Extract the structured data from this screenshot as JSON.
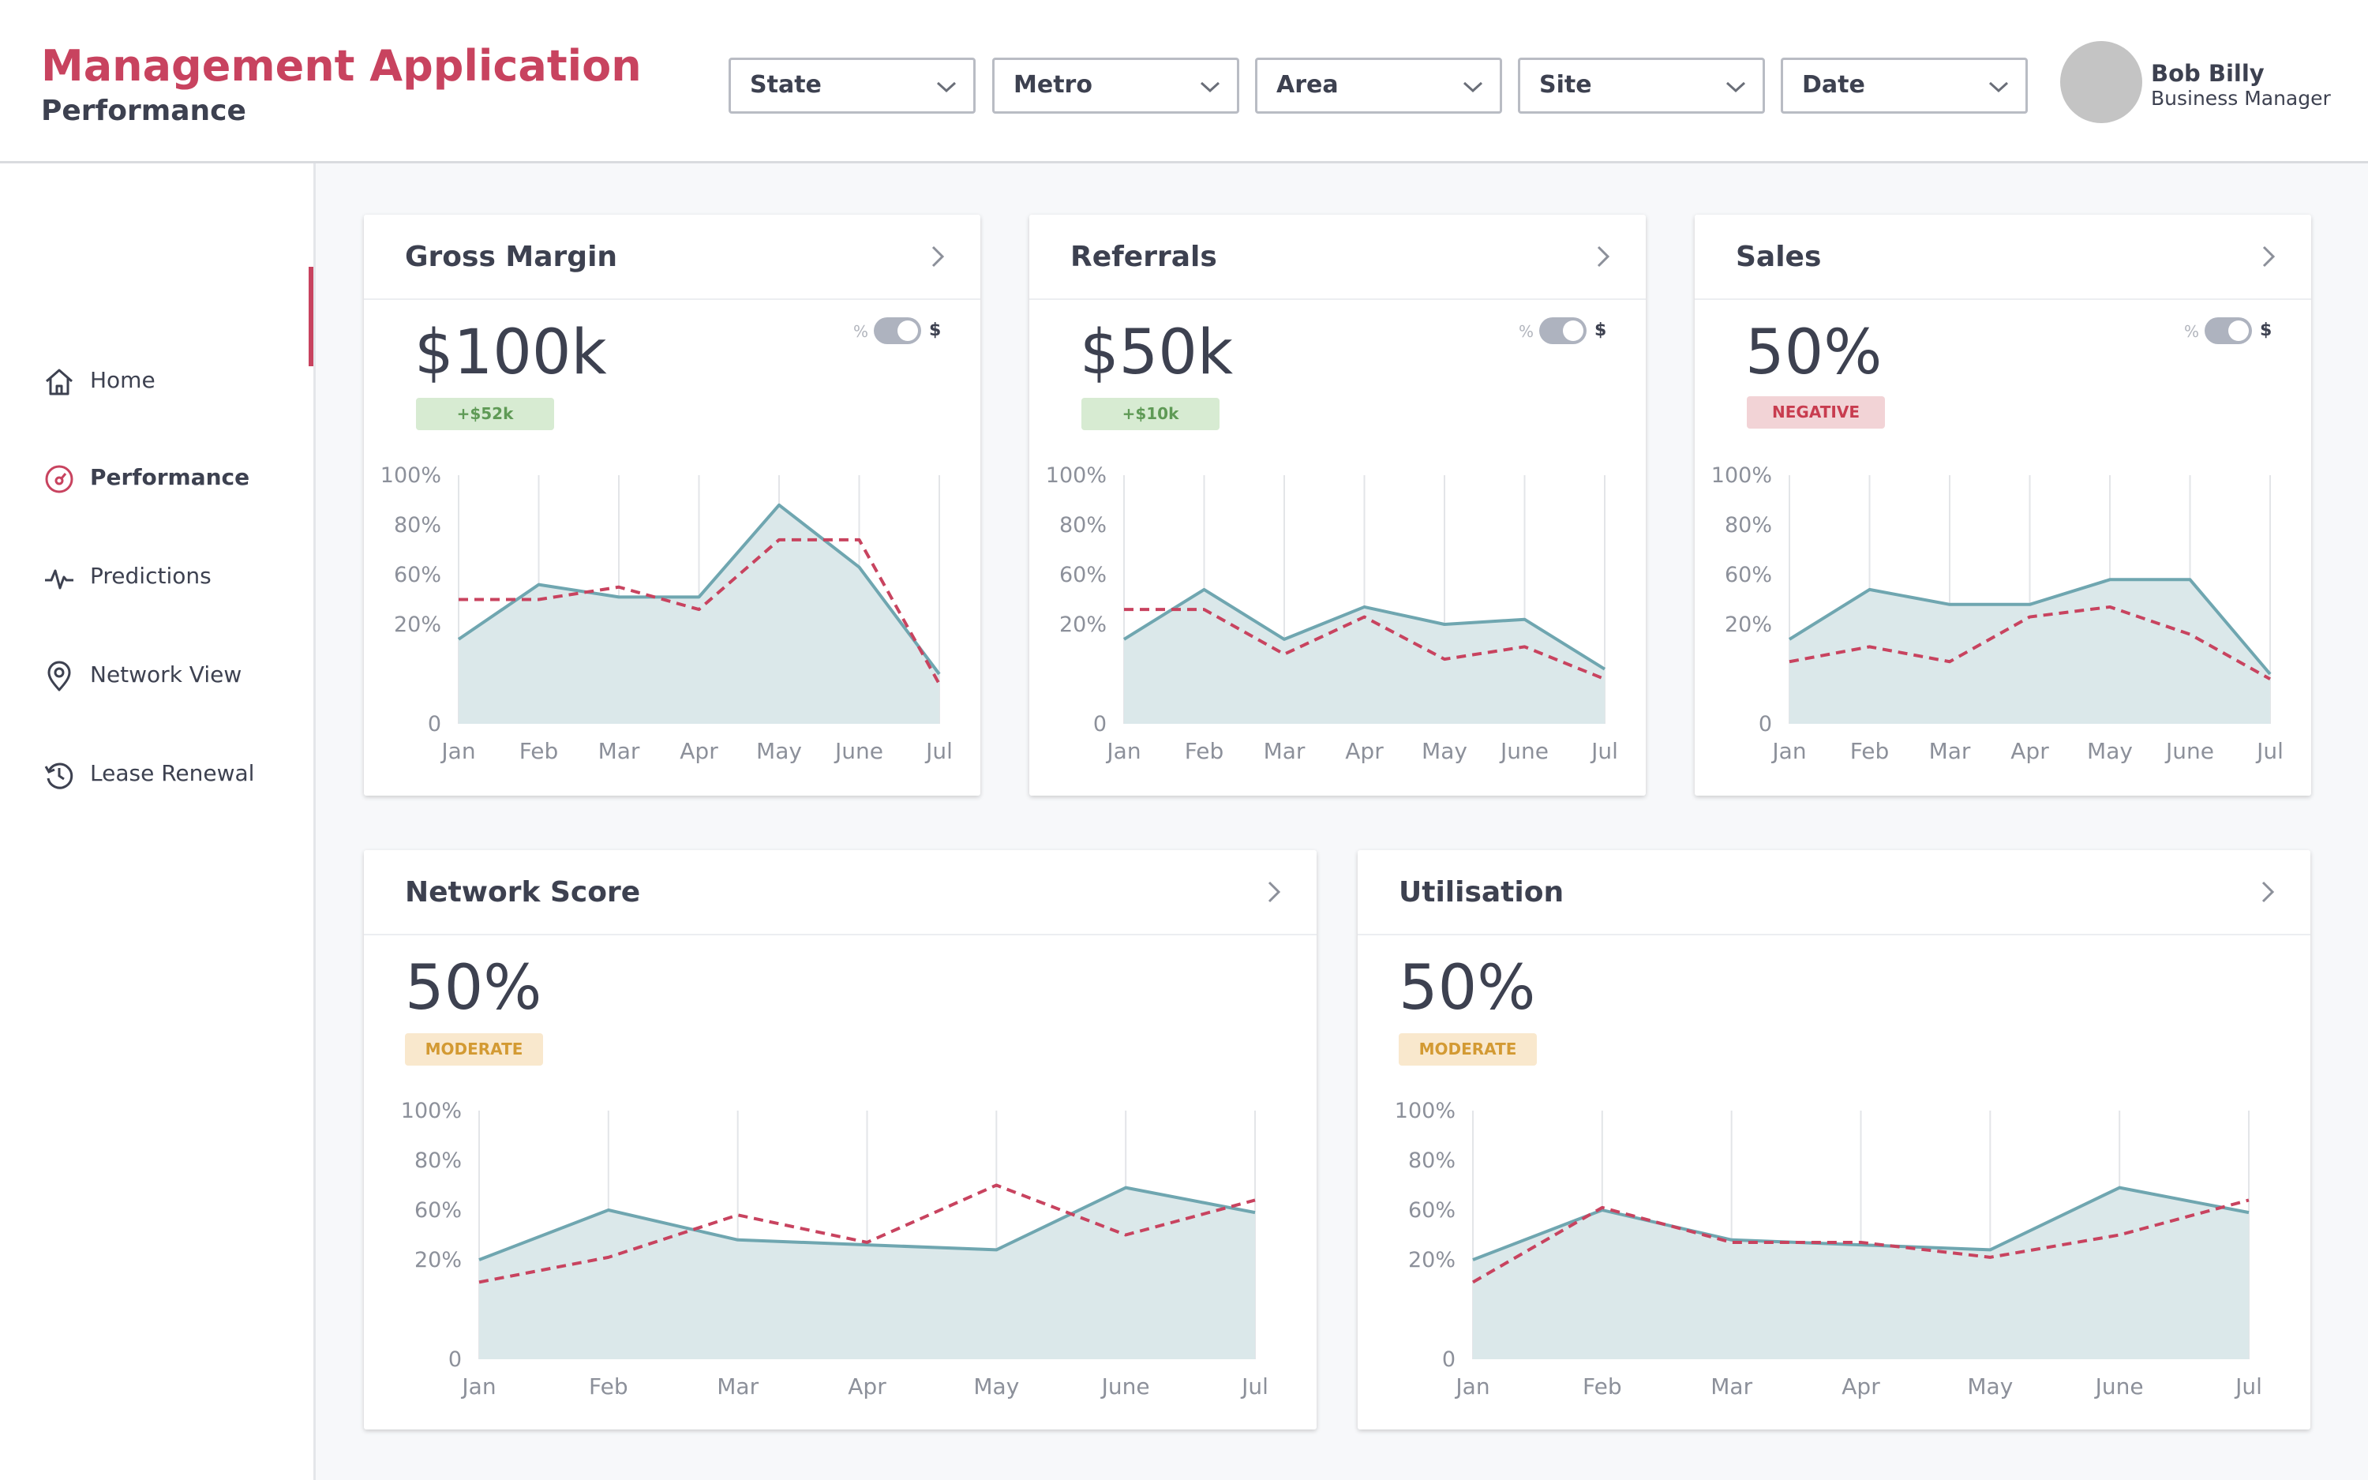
{
  "header": {
    "app_title": "Management Application",
    "page_subtitle": "Performance",
    "filters": [
      {
        "label": "State"
      },
      {
        "label": "Metro"
      },
      {
        "label": "Area"
      },
      {
        "label": "Site"
      },
      {
        "label": "Date"
      }
    ],
    "user": {
      "name": "Bob Billy",
      "role": "Business Manager"
    }
  },
  "sidebar": {
    "items": [
      {
        "label": "Home",
        "icon": "home-icon",
        "active": false
      },
      {
        "label": "Performance",
        "icon": "gauge-icon",
        "active": true
      },
      {
        "label": "Predictions",
        "icon": "pulse-icon",
        "active": false
      },
      {
        "label": "Network View",
        "icon": "location-pin-icon",
        "active": false
      },
      {
        "label": "Lease Renewal",
        "icon": "history-icon",
        "active": false
      }
    ]
  },
  "toggle": {
    "left_label": "%",
    "right_label": "$"
  },
  "colors": {
    "accent": "#c8435f",
    "area_fill": "#dbe8ea",
    "area_line": "#6fa6b0",
    "dashed_line": "#c8435f",
    "badge_positive": "#d7ebd2",
    "badge_negative": "#f2d3d6",
    "badge_moderate": "#f9e8cd"
  },
  "cards": {
    "gross_margin": {
      "title": "Gross Margin",
      "value": "$100k",
      "badge": "+$52k"
    },
    "referrals": {
      "title": "Referrals",
      "value": "$50k",
      "badge": "+$10k"
    },
    "sales": {
      "title": "Sales",
      "value": "50%",
      "badge": "NEGATIVE"
    },
    "network_score": {
      "title": "Network Score",
      "value": "50%",
      "badge": "MODERATE"
    },
    "utilisation": {
      "title": "Utilisation",
      "value": "50%",
      "badge": "MODERATE"
    }
  },
  "chart_data": [
    {
      "type": "area",
      "categories": [
        "Jan",
        "Feb",
        "Mar",
        "Apr",
        "May",
        "June",
        "Jul"
      ],
      "y_ticks": [
        "100%",
        "80%",
        "60%",
        "20%",
        "0"
      ],
      "ylim": [
        0,
        100
      ],
      "series": [
        {
          "style": "area",
          "values": [
            34,
            56,
            51,
            51,
            88,
            63,
            20
          ]
        },
        {
          "style": "dashed",
          "values": [
            50,
            50,
            55,
            46,
            74,
            74,
            16
          ]
        }
      ]
    },
    {
      "type": "area",
      "categories": [
        "Jan",
        "Feb",
        "Mar",
        "Apr",
        "May",
        "June",
        "Jul"
      ],
      "y_ticks": [
        "100%",
        "80%",
        "60%",
        "20%",
        "0"
      ],
      "ylim": [
        0,
        100
      ],
      "series": [
        {
          "style": "area",
          "values": [
            34,
            54,
            34,
            47,
            40,
            42,
            22
          ]
        },
        {
          "style": "dashed",
          "values": [
            46,
            46,
            28,
            43,
            26,
            31,
            18
          ]
        }
      ]
    },
    {
      "type": "area",
      "categories": [
        "Jan",
        "Feb",
        "Mar",
        "Apr",
        "May",
        "June",
        "Jul"
      ],
      "y_ticks": [
        "100%",
        "80%",
        "60%",
        "20%",
        "0"
      ],
      "ylim": [
        0,
        100
      ],
      "series": [
        {
          "style": "area",
          "values": [
            34,
            54,
            48,
            48,
            58,
            58,
            20
          ]
        },
        {
          "style": "dashed",
          "values": [
            25,
            31,
            25,
            43,
            47,
            36,
            18
          ]
        }
      ]
    },
    {
      "type": "area",
      "categories": [
        "Jan",
        "Feb",
        "Mar",
        "Apr",
        "May",
        "June",
        "Jul"
      ],
      "y_ticks": [
        "100%",
        "80%",
        "60%",
        "20%",
        "0"
      ],
      "ylim": [
        0,
        100
      ],
      "series": [
        {
          "style": "area",
          "values": [
            40,
            60,
            48,
            46,
            44,
            69,
            59
          ]
        },
        {
          "style": "dashed",
          "values": [
            31,
            41,
            58,
            47,
            70,
            50,
            64
          ]
        }
      ]
    },
    {
      "type": "area",
      "categories": [
        "Jan",
        "Feb",
        "Mar",
        "Apr",
        "May",
        "June",
        "Jul"
      ],
      "y_ticks": [
        "100%",
        "80%",
        "60%",
        "20%",
        "0"
      ],
      "ylim": [
        0,
        100
      ],
      "series": [
        {
          "style": "area",
          "values": [
            40,
            60,
            48,
            46,
            44,
            69,
            59
          ]
        },
        {
          "style": "dashed",
          "values": [
            31,
            61,
            47,
            47,
            41,
            50,
            64
          ]
        }
      ]
    }
  ]
}
